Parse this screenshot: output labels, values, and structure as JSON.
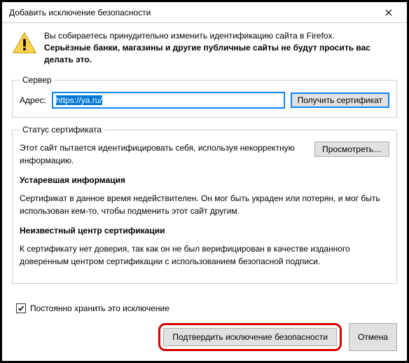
{
  "window": {
    "title": "Добавить исключение безопасности"
  },
  "warning": {
    "line1": "Вы собираетесь принудительно изменить идентификацию сайта в Firefox.",
    "line2": "Серьёзные банки, магазины и другие публичные сайты не будут просить вас делать это."
  },
  "server": {
    "legend": "Сервер",
    "address_label": "Адрес:",
    "address_value": "https://ya.ru/",
    "get_cert_button": "Получить сертификат"
  },
  "status": {
    "legend": "Статус сертификата",
    "identify_text": "Этот сайт пытается идентифицировать себя, используя некорректную информацию.",
    "view_button": "Просмотреть…",
    "stale_heading": "Устаревшая информация",
    "stale_text": "Сертификат в данное время недействителен. Он мог быть украден или потерян, и мог быть использован кем-то, чтобы подменить этот сайт другим.",
    "unknown_ca_heading": "Неизвестный центр сертификации",
    "unknown_ca_text": "К сертификату нет доверия, так как он не был верифицирован в качестве изданного доверенным центром сертификации с использованием безопасной подписи."
  },
  "checkbox": {
    "label": "Постоянно хранить это исключение",
    "checked": true
  },
  "buttons": {
    "confirm": "Подтвердить исключение безопасности",
    "cancel": "Отмена"
  }
}
